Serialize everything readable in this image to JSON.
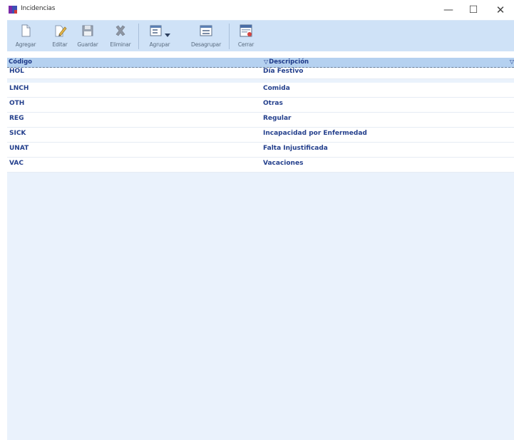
{
  "window": {
    "title": "Incidencias",
    "controls": {
      "minimize": "—",
      "maximize": "☐",
      "close": "✕"
    }
  },
  "toolbar": {
    "buttons": [
      {
        "label": "Agregar",
        "icon": "new-document-icon"
      },
      {
        "label": "Editar",
        "icon": "edit-pencil-icon"
      },
      {
        "label": "Guardar",
        "icon": "save-disk-icon"
      },
      {
        "label": "Eliminar",
        "icon": "delete-x-icon"
      },
      {
        "label": "Agrupar",
        "icon": "group-icon"
      },
      {
        "label": "Desagrupar",
        "icon": "ungroup-icon"
      },
      {
        "label": "Cerrar",
        "icon": "close-window-icon"
      }
    ]
  },
  "grid": {
    "columns": [
      "Código",
      "Descripción"
    ],
    "filter_glyph": "▽",
    "rows": [
      {
        "code": "HOL",
        "description": "Día Festivo"
      },
      {
        "code": "LNCH",
        "description": "Comida"
      },
      {
        "code": "OTH",
        "description": "Otras"
      },
      {
        "code": "REG",
        "description": "Regular"
      },
      {
        "code": "SICK",
        "description": "Incapacidad por Enfermedad"
      },
      {
        "code": "UNAT",
        "description": "Falta Injustificada"
      },
      {
        "code": "VAC",
        "description": "Vacaciones"
      }
    ]
  },
  "colors": {
    "toolbar_bg": "#cfe2f7",
    "header_bg": "#b5d1f0",
    "body_bg": "#eaf2fc",
    "row_text": "#233f8c",
    "app_icon": "#3d4fb5"
  }
}
